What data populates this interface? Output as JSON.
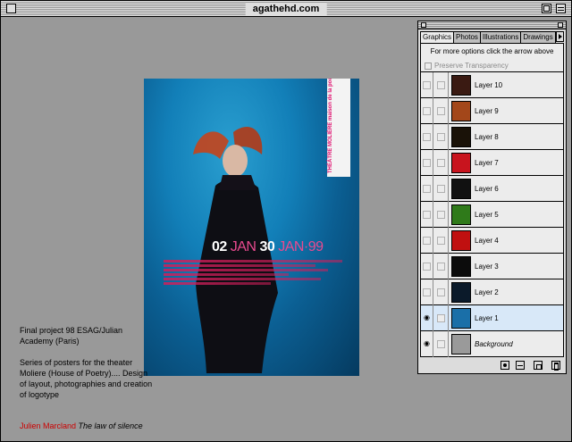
{
  "window": {
    "title": "agathehd.com"
  },
  "poster": {
    "date_day1": "02",
    "date_mon1": "JAN",
    "date_day2": "30",
    "date_mon2": "JAN·99",
    "side_tag": "THÉÂTRE MOLIÈRE maison de la poésie"
  },
  "description": {
    "line1": "Final project 98 ESAG/Julian Academy (Paris)",
    "line2": "Series of posters for the theater Moliere (House of Poetry).... Design of layout, photographies and creation of logotype"
  },
  "credit": {
    "author": "Julien Marcland",
    "work": "The law of silence"
  },
  "palette": {
    "tabs": [
      "Graphics",
      "Photos",
      "Illustrations",
      "Drawings"
    ],
    "active_tab": "Graphics",
    "hint": "For more options click the arrow above",
    "preserve_label": "Preserve Transparency",
    "layers": [
      {
        "name": "Layer 10",
        "visible": false,
        "selected": false,
        "thumb": "#3a1a12"
      },
      {
        "name": "Layer 9",
        "visible": false,
        "selected": false,
        "thumb": "#a3471a"
      },
      {
        "name": "Layer 8",
        "visible": false,
        "selected": false,
        "thumb": "#1a1208"
      },
      {
        "name": "Layer 7",
        "visible": false,
        "selected": false,
        "thumb": "#c8141e"
      },
      {
        "name": "Layer 6",
        "visible": false,
        "selected": false,
        "thumb": "#111111"
      },
      {
        "name": "Layer 5",
        "visible": false,
        "selected": false,
        "thumb": "#2f7a1a"
      },
      {
        "name": "Layer 4",
        "visible": false,
        "selected": false,
        "thumb": "#c01010"
      },
      {
        "name": "Layer 3",
        "visible": false,
        "selected": false,
        "thumb": "#0c0c0c"
      },
      {
        "name": "Layer 2",
        "visible": false,
        "selected": false,
        "thumb": "#0b1a2a"
      },
      {
        "name": "Layer 1",
        "visible": true,
        "selected": true,
        "thumb": "#1a6fa8"
      },
      {
        "name": "Background",
        "visible": true,
        "selected": false,
        "thumb": "#9a9a9a"
      }
    ]
  }
}
